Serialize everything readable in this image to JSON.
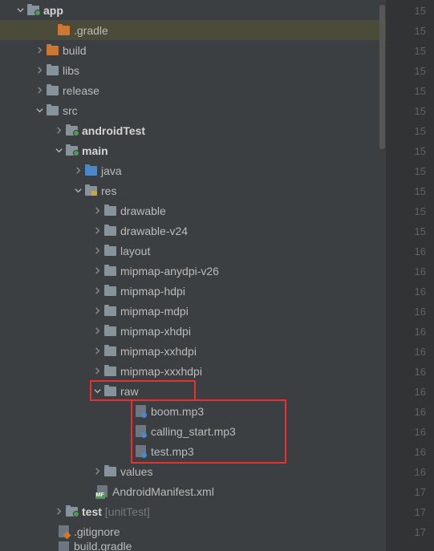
{
  "lineNumbers": [
    "15",
    "15",
    "15",
    "15",
    "15",
    "15",
    "15",
    "15",
    "15",
    "15",
    "15",
    "15",
    "16",
    "16",
    "16",
    "16",
    "16",
    "16",
    "16",
    "16",
    "16",
    "16",
    "16",
    "16",
    "17",
    "17",
    "17"
  ],
  "tree": {
    "app": "app",
    "gradle": ".gradle",
    "build": "build",
    "libs": "libs",
    "release": "release",
    "src": "src",
    "androidTest": "androidTest",
    "main": "main",
    "java": "java",
    "res": "res",
    "drawable": "drawable",
    "drawable_v24": "drawable-v24",
    "layout": "layout",
    "mipmap_anydpi_v26": "mipmap-anydpi-v26",
    "mipmap_hdpi": "mipmap-hdpi",
    "mipmap_mdpi": "mipmap-mdpi",
    "mipmap_xhdpi": "mipmap-xhdpi",
    "mipmap_xxhdpi": "mipmap-xxhdpi",
    "mipmap_xxxhdpi": "mipmap-xxxhdpi",
    "raw": "raw",
    "boom": "boom.mp3",
    "calling_start": "calling_start.mp3",
    "test_mp3": "test.mp3",
    "values": "values",
    "manifest": "AndroidManifest.xml",
    "test": "test ",
    "test_suffix": "[unitTest]",
    "gitignore": ".gitignore",
    "build_gradle": "build.gradle"
  }
}
